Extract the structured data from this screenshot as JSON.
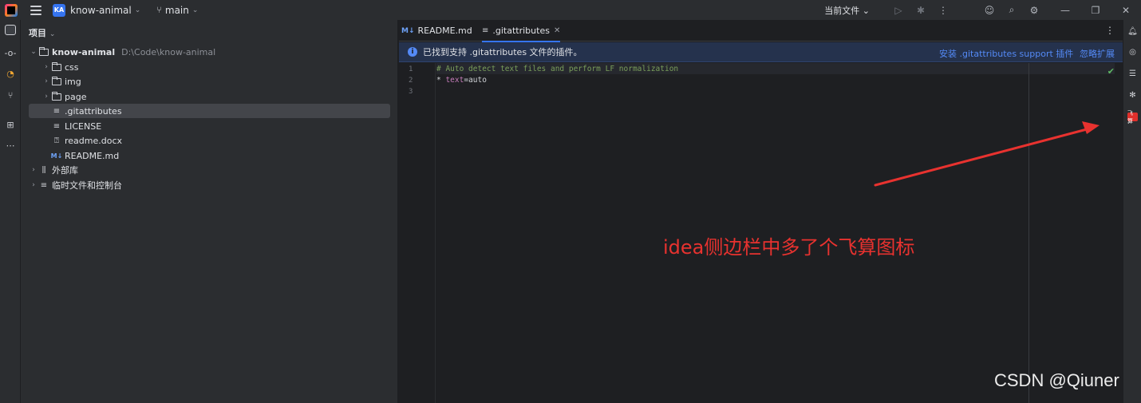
{
  "titlebar": {
    "project_badge": "KA",
    "project_name": "know-animal",
    "branch": "main",
    "current_file": "当前文件",
    "icons": [
      "app-logo",
      "hamburger-menu-icon",
      "branch-icon",
      "run-icon",
      "debug-icon",
      "more-icon",
      "account-icon",
      "search-icon",
      "settings-icon",
      "minimize-icon",
      "restore-icon",
      "close-icon"
    ]
  },
  "project_panel": {
    "header": "项目",
    "root": {
      "name": "know-animal",
      "path": "D:\\Code\\know-animal"
    },
    "items": [
      {
        "label": "css",
        "type": "folder"
      },
      {
        "label": "img",
        "type": "folder"
      },
      {
        "label": "page",
        "type": "folder"
      },
      {
        "label": ".gitattributes",
        "type": "text",
        "selected": true
      },
      {
        "label": "LICENSE",
        "type": "text"
      },
      {
        "label": "readme.docx",
        "type": "unknown"
      },
      {
        "label": "README.md",
        "type": "markdown"
      }
    ],
    "external_libs": "外部库",
    "scratches": "临时文件和控制台"
  },
  "editor": {
    "tabs": [
      {
        "label": "README.md",
        "icon": "M↓"
      },
      {
        "label": ".gitattributes",
        "active": true
      }
    ],
    "banner": {
      "text": "已找到支持 .gitattributes 文件的插件。",
      "install_link": "安装 .gitattributes support 插件",
      "ignore_link": "忽略扩展"
    },
    "line_numbers": [
      "1",
      "2",
      "3"
    ],
    "code": {
      "line1": "# Auto detect text files and perform LF normalization",
      "line2_star": "* ",
      "line2_key": "text",
      "line2_eq": "=",
      "line2_val": "auto"
    }
  },
  "right_strip": {
    "feisuan_label": "飞算"
  },
  "annotation": {
    "text": "idea侧边栏中多了个飞算图标",
    "color": "#e8322f"
  },
  "watermark": "CSDN @Qiuner",
  "colors": {
    "accent": "#3574f0",
    "link": "#548af7",
    "banner_bg": "#25324d",
    "annotation_red": "#e8322f"
  }
}
